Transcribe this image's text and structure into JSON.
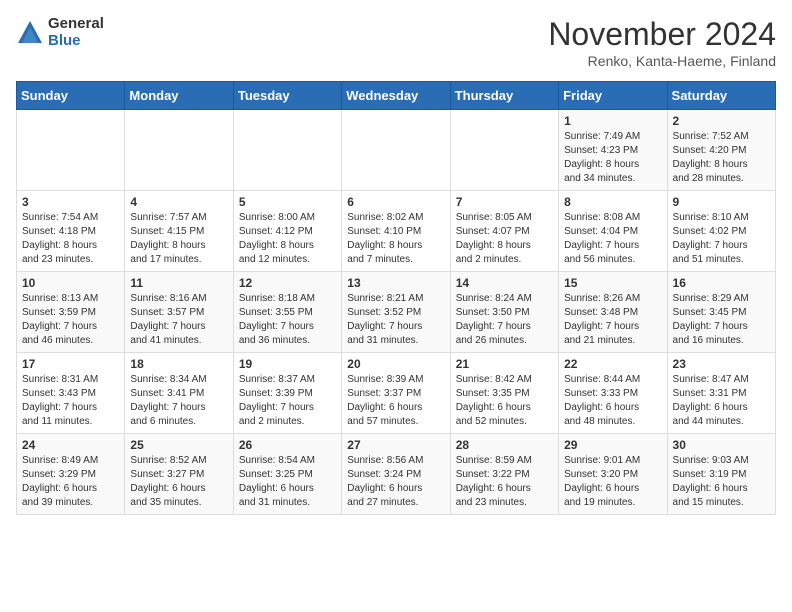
{
  "header": {
    "logo_general": "General",
    "logo_blue": "Blue",
    "month_title": "November 2024",
    "location": "Renko, Kanta-Haeme, Finland"
  },
  "weekdays": [
    "Sunday",
    "Monday",
    "Tuesday",
    "Wednesday",
    "Thursday",
    "Friday",
    "Saturday"
  ],
  "weeks": [
    [
      {
        "day": "",
        "info": ""
      },
      {
        "day": "",
        "info": ""
      },
      {
        "day": "",
        "info": ""
      },
      {
        "day": "",
        "info": ""
      },
      {
        "day": "",
        "info": ""
      },
      {
        "day": "1",
        "info": "Sunrise: 7:49 AM\nSunset: 4:23 PM\nDaylight: 8 hours\nand 34 minutes."
      },
      {
        "day": "2",
        "info": "Sunrise: 7:52 AM\nSunset: 4:20 PM\nDaylight: 8 hours\nand 28 minutes."
      }
    ],
    [
      {
        "day": "3",
        "info": "Sunrise: 7:54 AM\nSunset: 4:18 PM\nDaylight: 8 hours\nand 23 minutes."
      },
      {
        "day": "4",
        "info": "Sunrise: 7:57 AM\nSunset: 4:15 PM\nDaylight: 8 hours\nand 17 minutes."
      },
      {
        "day": "5",
        "info": "Sunrise: 8:00 AM\nSunset: 4:12 PM\nDaylight: 8 hours\nand 12 minutes."
      },
      {
        "day": "6",
        "info": "Sunrise: 8:02 AM\nSunset: 4:10 PM\nDaylight: 8 hours\nand 7 minutes."
      },
      {
        "day": "7",
        "info": "Sunrise: 8:05 AM\nSunset: 4:07 PM\nDaylight: 8 hours\nand 2 minutes."
      },
      {
        "day": "8",
        "info": "Sunrise: 8:08 AM\nSunset: 4:04 PM\nDaylight: 7 hours\nand 56 minutes."
      },
      {
        "day": "9",
        "info": "Sunrise: 8:10 AM\nSunset: 4:02 PM\nDaylight: 7 hours\nand 51 minutes."
      }
    ],
    [
      {
        "day": "10",
        "info": "Sunrise: 8:13 AM\nSunset: 3:59 PM\nDaylight: 7 hours\nand 46 minutes."
      },
      {
        "day": "11",
        "info": "Sunrise: 8:16 AM\nSunset: 3:57 PM\nDaylight: 7 hours\nand 41 minutes."
      },
      {
        "day": "12",
        "info": "Sunrise: 8:18 AM\nSunset: 3:55 PM\nDaylight: 7 hours\nand 36 minutes."
      },
      {
        "day": "13",
        "info": "Sunrise: 8:21 AM\nSunset: 3:52 PM\nDaylight: 7 hours\nand 31 minutes."
      },
      {
        "day": "14",
        "info": "Sunrise: 8:24 AM\nSunset: 3:50 PM\nDaylight: 7 hours\nand 26 minutes."
      },
      {
        "day": "15",
        "info": "Sunrise: 8:26 AM\nSunset: 3:48 PM\nDaylight: 7 hours\nand 21 minutes."
      },
      {
        "day": "16",
        "info": "Sunrise: 8:29 AM\nSunset: 3:45 PM\nDaylight: 7 hours\nand 16 minutes."
      }
    ],
    [
      {
        "day": "17",
        "info": "Sunrise: 8:31 AM\nSunset: 3:43 PM\nDaylight: 7 hours\nand 11 minutes."
      },
      {
        "day": "18",
        "info": "Sunrise: 8:34 AM\nSunset: 3:41 PM\nDaylight: 7 hours\nand 6 minutes."
      },
      {
        "day": "19",
        "info": "Sunrise: 8:37 AM\nSunset: 3:39 PM\nDaylight: 7 hours\nand 2 minutes."
      },
      {
        "day": "20",
        "info": "Sunrise: 8:39 AM\nSunset: 3:37 PM\nDaylight: 6 hours\nand 57 minutes."
      },
      {
        "day": "21",
        "info": "Sunrise: 8:42 AM\nSunset: 3:35 PM\nDaylight: 6 hours\nand 52 minutes."
      },
      {
        "day": "22",
        "info": "Sunrise: 8:44 AM\nSunset: 3:33 PM\nDaylight: 6 hours\nand 48 minutes."
      },
      {
        "day": "23",
        "info": "Sunrise: 8:47 AM\nSunset: 3:31 PM\nDaylight: 6 hours\nand 44 minutes."
      }
    ],
    [
      {
        "day": "24",
        "info": "Sunrise: 8:49 AM\nSunset: 3:29 PM\nDaylight: 6 hours\nand 39 minutes."
      },
      {
        "day": "25",
        "info": "Sunrise: 8:52 AM\nSunset: 3:27 PM\nDaylight: 6 hours\nand 35 minutes."
      },
      {
        "day": "26",
        "info": "Sunrise: 8:54 AM\nSunset: 3:25 PM\nDaylight: 6 hours\nand 31 minutes."
      },
      {
        "day": "27",
        "info": "Sunrise: 8:56 AM\nSunset: 3:24 PM\nDaylight: 6 hours\nand 27 minutes."
      },
      {
        "day": "28",
        "info": "Sunrise: 8:59 AM\nSunset: 3:22 PM\nDaylight: 6 hours\nand 23 minutes."
      },
      {
        "day": "29",
        "info": "Sunrise: 9:01 AM\nSunset: 3:20 PM\nDaylight: 6 hours\nand 19 minutes."
      },
      {
        "day": "30",
        "info": "Sunrise: 9:03 AM\nSunset: 3:19 PM\nDaylight: 6 hours\nand 15 minutes."
      }
    ]
  ]
}
